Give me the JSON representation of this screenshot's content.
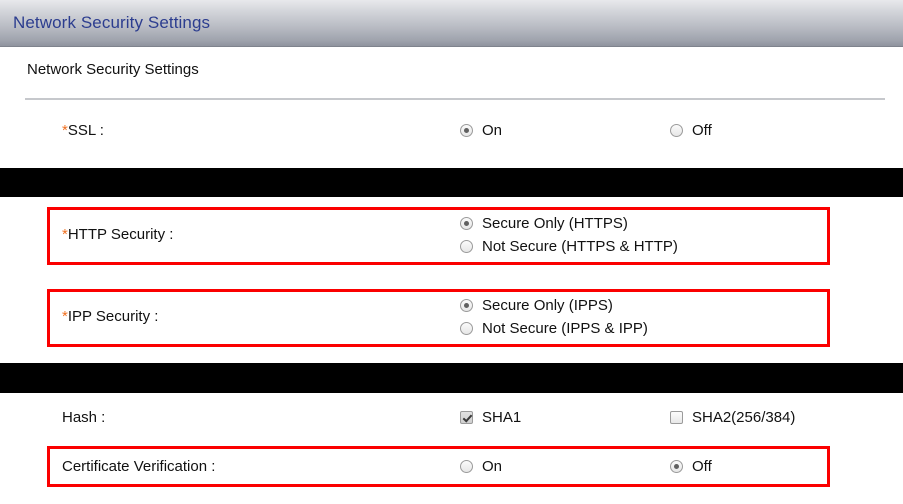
{
  "window": {
    "title": "Network Security Settings"
  },
  "page": {
    "section_title": "Network Security Settings"
  },
  "rows": [
    {
      "id": "ssl",
      "label": "SSL :",
      "required_marker": "*",
      "control_type": "radio",
      "options": [
        {
          "label": "On",
          "checked": true
        },
        {
          "label": "Off",
          "checked": false
        }
      ]
    },
    {
      "id": "http-security",
      "label": "HTTP Security :",
      "required_marker": "*",
      "control_type": "radio",
      "highlighted": true,
      "options": [
        {
          "label": "Secure Only (HTTPS)",
          "checked": true
        },
        {
          "label": "Not Secure (HTTPS & HTTP)",
          "checked": false
        }
      ]
    },
    {
      "id": "ipp-security",
      "label": "IPP Security :",
      "required_marker": "*",
      "control_type": "radio",
      "highlighted": true,
      "options": [
        {
          "label": "Secure Only (IPPS)",
          "checked": true
        },
        {
          "label": "Not Secure (IPPS & IPP)",
          "checked": false
        }
      ]
    },
    {
      "id": "hash",
      "label": "Hash :",
      "required_marker": "",
      "control_type": "checkbox",
      "options": [
        {
          "label": "SHA1",
          "checked": true
        },
        {
          "label": "SHA2(256/384)",
          "checked": false
        }
      ]
    },
    {
      "id": "certificate-verification",
      "label": "Certificate Verification :",
      "required_marker": "",
      "control_type": "radio",
      "highlighted": true,
      "options": [
        {
          "label": "On",
          "checked": false
        },
        {
          "label": "Off",
          "checked": true
        }
      ]
    }
  ],
  "colors": {
    "highlight_box": "#fb0000",
    "title_text": "#2c3d8f",
    "required_marker": "#f07020",
    "redaction_band": "#000000"
  }
}
